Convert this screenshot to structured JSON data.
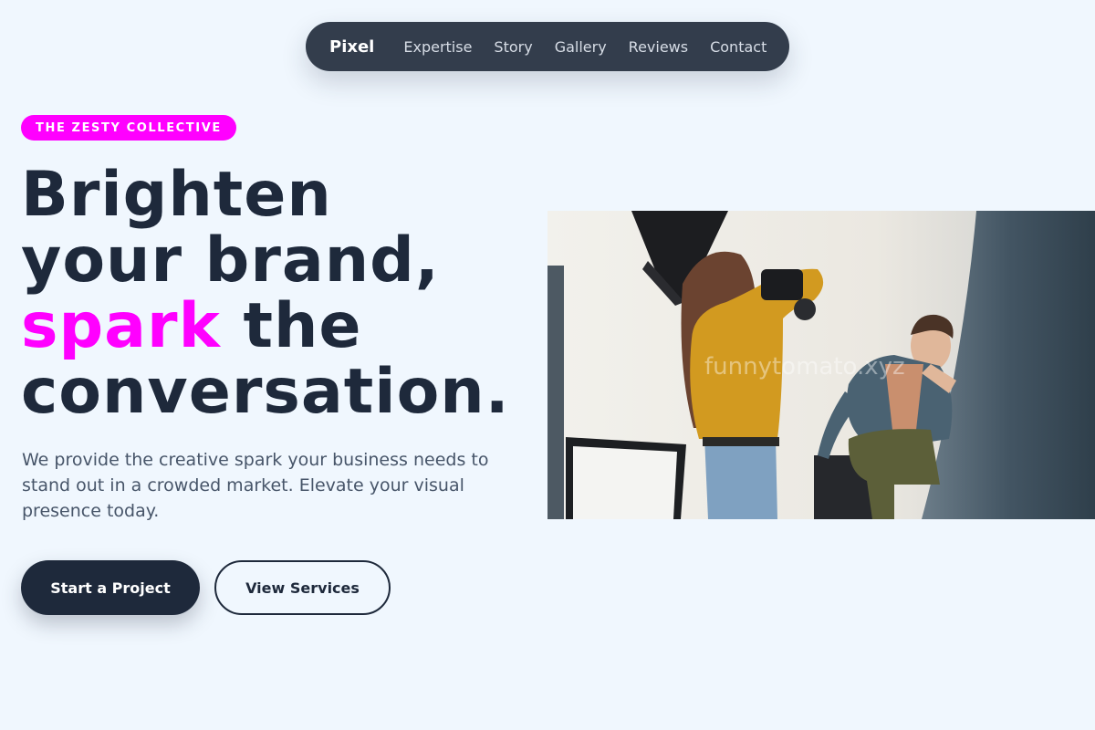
{
  "nav": {
    "brand": "Pixel",
    "links": [
      "Expertise",
      "Story",
      "Gallery",
      "Reviews",
      "Contact"
    ]
  },
  "hero": {
    "badge": "THE ZESTY COLLECTIVE",
    "headline": {
      "line1": "Brighten",
      "line2": "your brand,",
      "line3_accent": "spark",
      "line3_rest": " the",
      "line4": "conversation."
    },
    "lead": "We provide the creative spark your business needs to stand out in a crowded market. Elevate your visual presence today.",
    "primary_button": "Start a Project",
    "secondary_button": "View Services"
  },
  "image": {
    "watermark": "funnytomato.xyz"
  },
  "colors": {
    "background": "#f0f7fe",
    "nav_bg": "#333d4c",
    "accent": "#ff00ff",
    "text_dark": "#1e293b",
    "text_muted": "#475569"
  }
}
